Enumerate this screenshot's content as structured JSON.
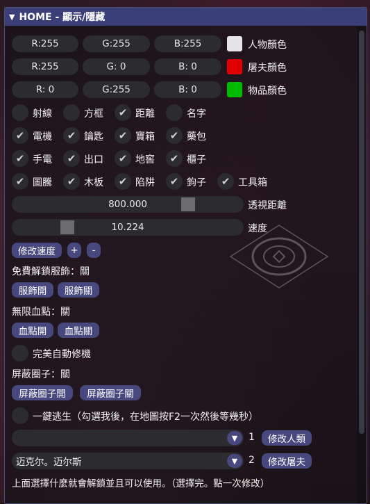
{
  "window": {
    "title": "HOME - 顯示/隱藏"
  },
  "colors": {
    "rows": [
      {
        "r": "R:255",
        "g": "G:255",
        "b": "B:255",
        "swatch": "#e6e4e6",
        "label": "人物顏色"
      },
      {
        "r": "R:255",
        "g": "G:  0",
        "b": "B:  0",
        "swatch": "#e00000",
        "label": "屠夫顏色"
      },
      {
        "r": "R:  0",
        "g": "G:255",
        "b": "B:  0",
        "swatch": "#00bb00",
        "label": "物品顏色"
      }
    ]
  },
  "toggles": {
    "row1": [
      {
        "label": "射線",
        "checked": false
      },
      {
        "label": "方框",
        "checked": false
      },
      {
        "label": "距離",
        "checked": true
      },
      {
        "label": "名字",
        "checked": false
      }
    ],
    "row2": [
      {
        "label": "電機",
        "checked": true
      },
      {
        "label": "鑰匙",
        "checked": true
      },
      {
        "label": "寶箱",
        "checked": true
      },
      {
        "label": "藥包",
        "checked": true
      }
    ],
    "row3": [
      {
        "label": "手電",
        "checked": true
      },
      {
        "label": "出口",
        "checked": true
      },
      {
        "label": "地窖",
        "checked": true
      },
      {
        "label": "櫃子",
        "checked": true
      }
    ],
    "row4": [
      {
        "label": "圖騰",
        "checked": true
      },
      {
        "label": "木板",
        "checked": true
      },
      {
        "label": "陷阱",
        "checked": true
      },
      {
        "label": "鉤子",
        "checked": true
      },
      {
        "label": "工具箱",
        "checked": true
      }
    ]
  },
  "sliders": {
    "distance": {
      "value": "800.000",
      "label": "透視距離",
      "fraction": 0.78
    },
    "speed": {
      "value": "10.224",
      "label": "速度",
      "fraction": 0.22
    }
  },
  "speed_buttons": {
    "modify": "修改速度",
    "plus": "+",
    "minus": "-"
  },
  "costume": {
    "status": "免費解鎖服飾：關",
    "on": "服飾開",
    "off": "服飾關"
  },
  "blood": {
    "status": "無限血點：關",
    "on": "血點開",
    "off": "血點關"
  },
  "auto_repair": {
    "label": "完美自動修機",
    "checked": false
  },
  "block_circle": {
    "status": "屏蔽圈子：關",
    "on": "屏蔽圈子開",
    "off": "屏蔽圈子關"
  },
  "escape": {
    "label": "一鍵逃生（勾選我後，在地圖按F2一次然後等幾秒）",
    "checked": false
  },
  "selectors": [
    {
      "value": "",
      "index": "1",
      "button": "修改人類"
    },
    {
      "value": "迈克尔。迈尔斯",
      "index": "2",
      "button": "修改屠夫"
    }
  ],
  "footer": {
    "note": "上面選擇什麼就會解鎖並且可以使用。（選擇完。點一次修改）"
  }
}
